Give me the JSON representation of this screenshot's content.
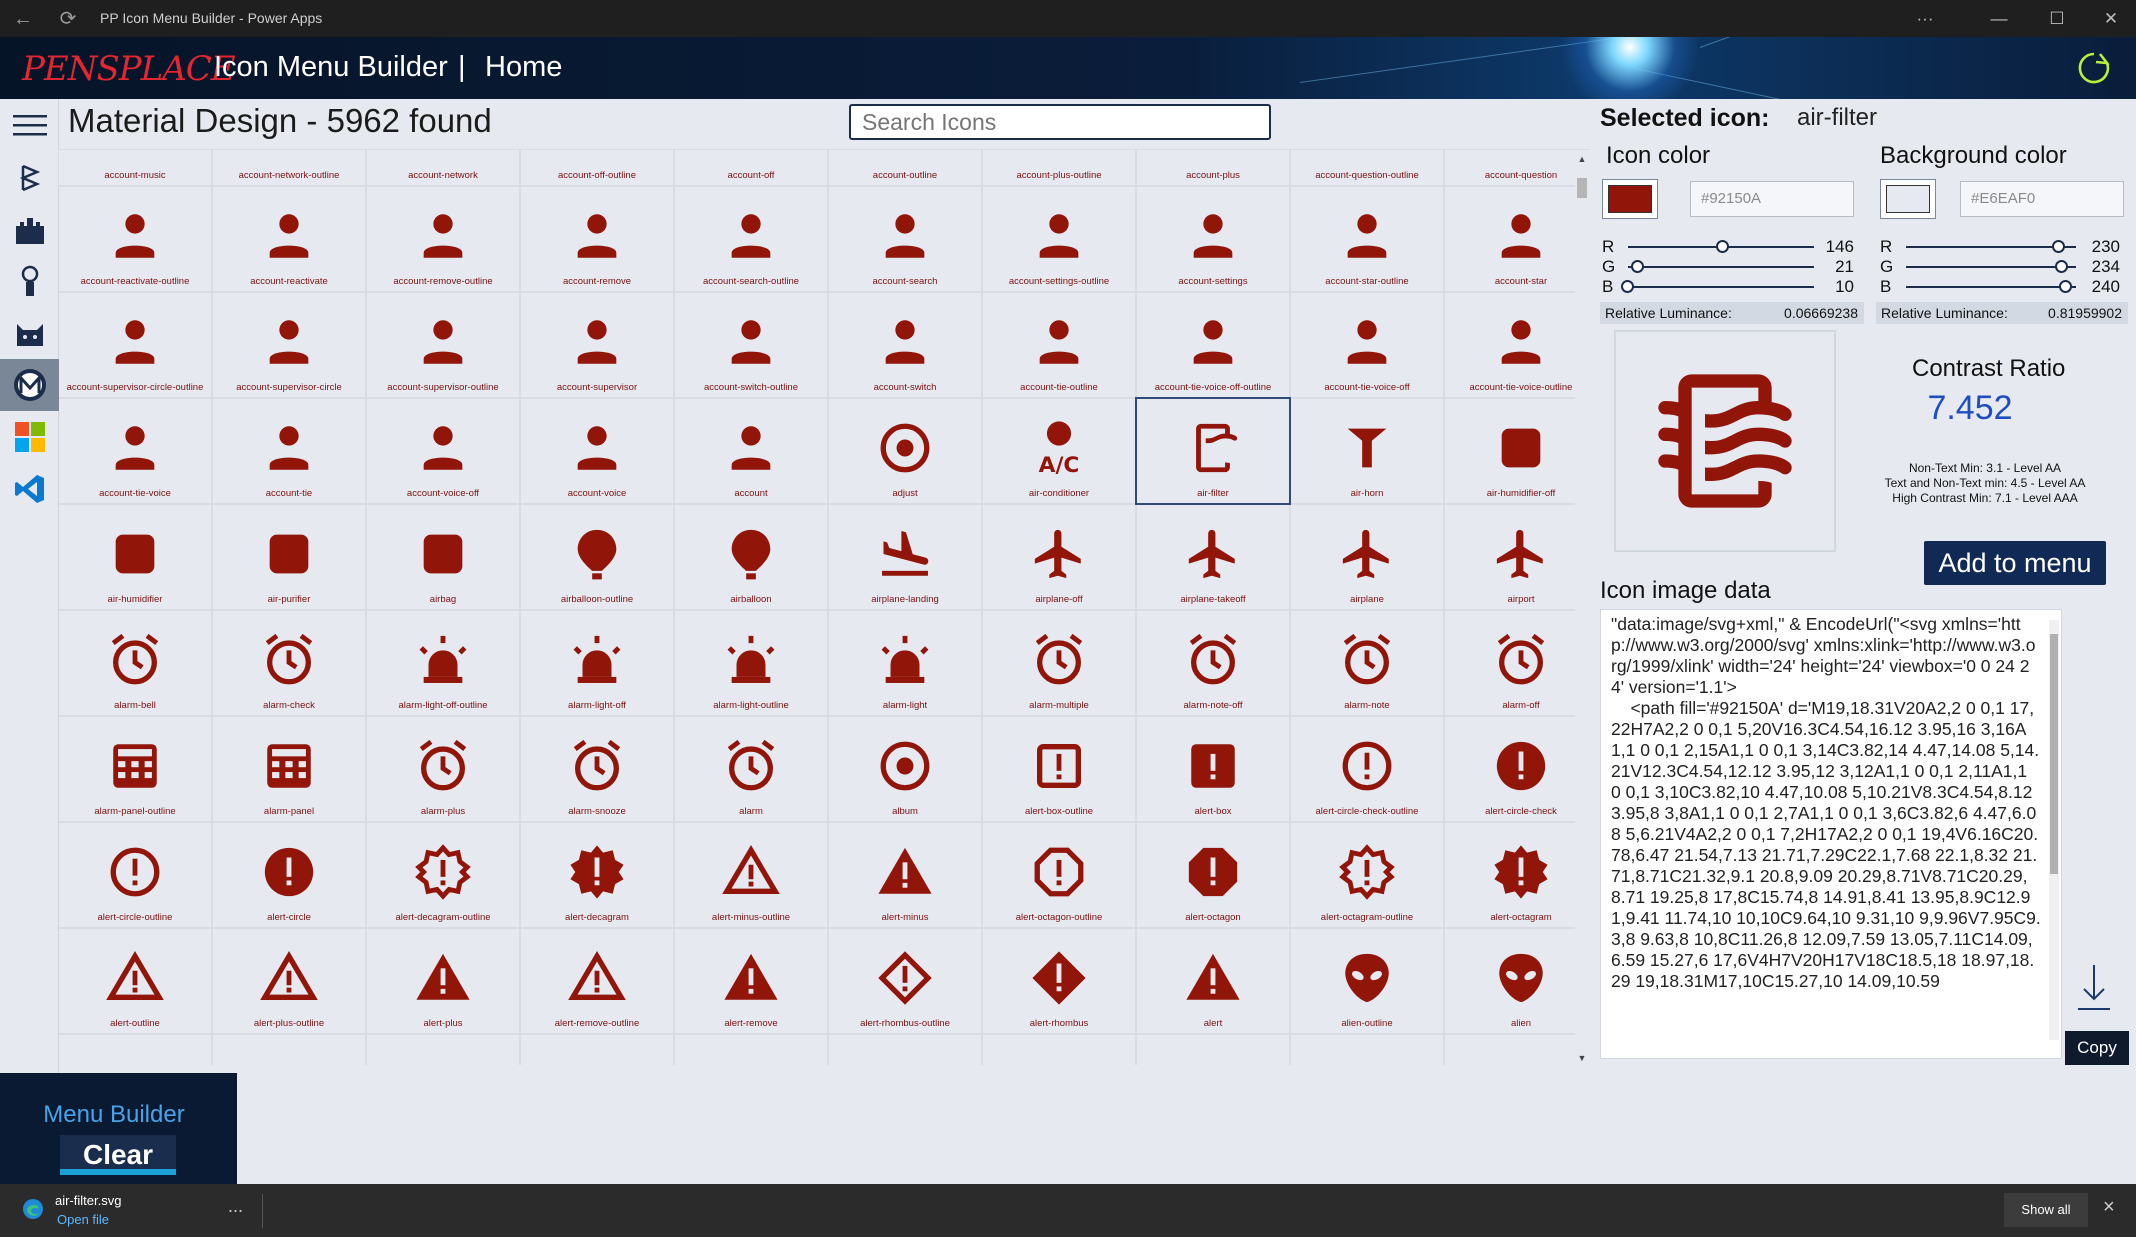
{
  "window": {
    "title": "PP Icon Menu Builder - Power Apps"
  },
  "header": {
    "brand": "PENSPLACE",
    "app_title": "Icon Menu Builder",
    "separator": "|",
    "page": "Home"
  },
  "main": {
    "title": "Material Design - 5962 found",
    "search_placeholder": "Search Icons",
    "top_partial_labels": [
      "account-music",
      "account-network-outline",
      "account-network",
      "account-off-outline",
      "account-off",
      "account-outline",
      "account-plus-outline",
      "account-plus",
      "account-question-outline",
      "account-question"
    ],
    "rows": [
      [
        "account-reactivate-outline",
        "account-reactivate",
        "account-remove-outline",
        "account-remove",
        "account-search-outline",
        "account-search",
        "account-settings-outline",
        "account-settings",
        "account-star-outline",
        "account-star"
      ],
      [
        "account-supervisor-circle-outline",
        "account-supervisor-circle",
        "account-supervisor-outline",
        "account-supervisor",
        "account-switch-outline",
        "account-switch",
        "account-tie-outline",
        "account-tie-voice-off-outline",
        "account-tie-voice-off",
        "account-tie-voice-outline"
      ],
      [
        "account-tie-voice",
        "account-tie",
        "account-voice-off",
        "account-voice",
        "account",
        "adjust",
        "air-conditioner",
        "air-filter",
        "air-horn",
        "air-humidifier-off"
      ],
      [
        "air-humidifier",
        "air-purifier",
        "airbag",
        "airballoon-outline",
        "airballoon",
        "airplane-landing",
        "airplane-off",
        "airplane-takeoff",
        "airplane",
        "airport"
      ],
      [
        "alarm-bell",
        "alarm-check",
        "alarm-light-off-outline",
        "alarm-light-off",
        "alarm-light-outline",
        "alarm-light",
        "alarm-multiple",
        "alarm-note-off",
        "alarm-note",
        "alarm-off"
      ],
      [
        "alarm-panel-outline",
        "alarm-panel",
        "alarm-plus",
        "alarm-snooze",
        "alarm",
        "album",
        "alert-box-outline",
        "alert-box",
        "alert-circle-check-outline",
        "alert-circle-check"
      ],
      [
        "alert-circle-outline",
        "alert-circle",
        "alert-decagram-outline",
        "alert-decagram",
        "alert-minus-outline",
        "alert-minus",
        "alert-octagon-outline",
        "alert-octagon",
        "alert-octagram-outline",
        "alert-octagram"
      ],
      [
        "alert-outline",
        "alert-plus-outline",
        "alert-plus",
        "alert-remove-outline",
        "alert-remove",
        "alert-rhombus-outline",
        "alert-rhombus",
        "alert",
        "alien-outline",
        "alien"
      ],
      [
        "",
        "",
        "",
        "",
        "",
        "",
        "",
        "",
        "",
        ""
      ]
    ]
  },
  "right_panel": {
    "selected_label": "Selected icon:",
    "selected_name": "air-filter",
    "icon_color": {
      "label": "Icon color",
      "hex": "#92150A",
      "r_label": "R",
      "g_label": "G",
      "b_label": "B",
      "r": 146,
      "g": 21,
      "b": 10,
      "lum_label": "Relative Luminance:",
      "lum_value": "0.06669238"
    },
    "background_color": {
      "label": "Background color",
      "hex": "#E6EAF0",
      "r_label": "R",
      "g_label": "G",
      "b_label": "B",
      "r": 230,
      "g": 234,
      "b": 240,
      "lum_label": "Relative Luminance:",
      "lum_value": "0.81959902"
    },
    "contrast": {
      "title": "Contrast Ratio",
      "value": "7.452",
      "note1": "Non-Text Min: 3.1 - Level AA",
      "note2": "Text and Non-Text min: 4.5 - Level AA",
      "note3": "High Contrast Min: 7.1 - Level AAA"
    },
    "add_button": "Add to menu",
    "image_data_label": "Icon image data",
    "image_data": "\"data:image/svg+xml,\" & EncodeUrl(\"<svg xmlns='http://www.w3.org/2000/svg' xmlns:xlink='http://www.w3.org/1999/xlink' width='24' height='24' viewbox='0 0 24 24' version='1.1'>\n    <path fill='#92150A' d='M19,18.31V20A2,2 0 0,1 17,22H7A2,2 0 0,1 5,20V16.3C4.54,16.12 3.95,16 3,16A1,1 0 0,1 2,15A1,1 0 0,1 3,14C3.82,14 4.47,14.08 5,14.21V12.3C4.54,12.12 3.95,12 3,12A1,1 0 0,1 2,11A1,1 0 0,1 3,10C3.82,10 4.47,10.08 5,10.21V8.3C4.54,8.12 3.95,8 3,8A1,1 0 0,1 2,7A1,1 0 0,1 3,6C3.82,6 4.47,6.08 5,6.21V4A2,2 0 0,1 7,2H17A2,2 0 0,1 19,4V6.16C20.78,6.47 21.54,7.13 21.71,7.29C22.1,7.68 22.1,8.32 21.71,8.71C21.32,9.1 20.8,9.09 20.29,8.71V8.71C20.29,8.71 19.25,8 17,8C15.74,8 14.91,8.41 13.95,8.9C12.91,9.41 11.74,10 10,10C9.64,10 9.31,10 9,9.96V7.95C9.3,8 9.63,8 10,8C11.26,8 12.09,7.59 13.05,7.11C14.09,6.59 15.27,6 17,6V4H7V20H17V18C18.5,18 18.97,18.29 19,18.31M17,10C15.27,10 14.09,10.59",
    "copy_button": "Copy"
  },
  "bottom": {
    "menu_builder": "Menu Builder",
    "clear_button": "Clear"
  },
  "download_bar": {
    "file": "air-filter.svg",
    "open": "Open file",
    "more": "...",
    "show_all": "Show all",
    "close": "×"
  },
  "colors": {
    "icon": "#92150A",
    "background": "#E6EAF0",
    "header": "#0a1d3a",
    "accent": "#1f4cc0"
  }
}
